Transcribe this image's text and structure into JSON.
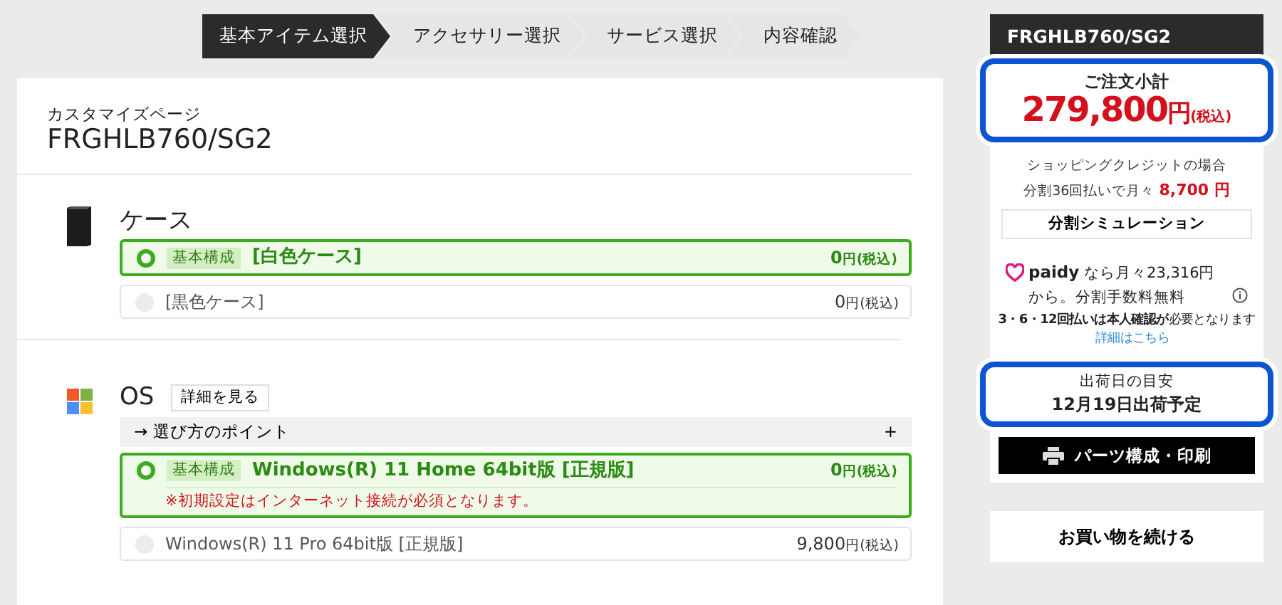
{
  "steps": [
    {
      "label": "基本アイテム選択",
      "selected": true
    },
    {
      "label": "アクセサリー選択",
      "selected": false
    },
    {
      "label": "サービス選択",
      "selected": false
    },
    {
      "label": "内容確認",
      "selected": false
    }
  ],
  "page": {
    "subtitle": "カスタマイズページ",
    "model": "FRGHLB760/SG2"
  },
  "sections": [
    {
      "kind": "case",
      "title": "ケース",
      "options": [
        {
          "selected": true,
          "badge": "基本構成",
          "label": "[白色ケース]",
          "amount": "0",
          "suffix": "円(税込)"
        },
        {
          "selected": false,
          "label": "[黒色ケース]",
          "amount": "0",
          "suffix": "円(税込)"
        }
      ]
    },
    {
      "kind": "os",
      "title": "OS",
      "detail_button": "詳細を見る",
      "point": {
        "label": "→ 選び方のポイント",
        "toggle": "+",
        "expanded": false
      },
      "options": [
        {
          "selected": true,
          "badge": "基本構成",
          "label": "Windows(R) 11 Home 64bit版 [正規版]",
          "note": "※初期設定はインターネット接続が必須となります。",
          "amount": "0",
          "suffix": "円(税込)"
        },
        {
          "selected": false,
          "label": "Windows(R) 11 Pro 64bit版 [正規版]",
          "amount": "9,800",
          "suffix": "円(税込)"
        }
      ]
    }
  ],
  "sidebar": {
    "model": "FRGHLB760/SG2",
    "subtotal": {
      "label": "ご注文小計",
      "amount": "279,800",
      "unit": "円",
      "tax": "(税込)"
    },
    "credit": {
      "line1": "ショッピングクレジットの場合",
      "line2": "分割36回払いで月々",
      "monthly": "8,700",
      "unit": "円"
    },
    "simulation_button": "分割シミュレーション",
    "paidy": {
      "brand": "paidy",
      "text": "なら月々23,316円から。分割手数料無料"
    },
    "paidy_note": "**3・6・12回払いは本人確認が**必要となります",
    "paidy_link": "詳細はこちら",
    "shipping": {
      "label": "出荷日の目安",
      "date": "12月19日出荷予定"
    },
    "print_button": "パーツ構成・印刷",
    "continue_button": "お買い物を続ける"
  }
}
